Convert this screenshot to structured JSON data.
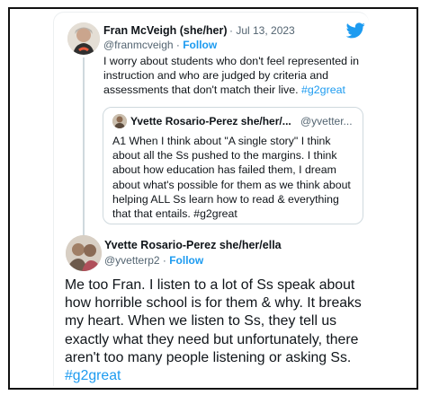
{
  "tweet": {
    "author_name": "Fran McVeigh (she/her)",
    "date": "· Jul 13, 2023",
    "handle": "@franmcveigh ·",
    "follow_label": "Follow",
    "text": "I worry about students who don't feel represented in instruction and who are judged by criteria and assessments that don't match their live.",
    "hashtag": "#g2great"
  },
  "quoted_tweet": {
    "author_name": "Yvette Rosario-Perez she/her/...",
    "handle": "@yvetter...",
    "text": "A1 When I think about \"A single story\" I think about all the Ss pushed to the margins. I think about how education has failed them, I dream about what's possible for them as we think about helping ALL Ss learn how to read & everything that that entails. #g2great"
  },
  "reply": {
    "author_name": "Yvette Rosario-Perez she/her/ella",
    "handle": "@yvetterp2 ·",
    "follow_label": "Follow",
    "text": "Me too Fran. I listen to a lot of Ss speak about how horrible school is for them & why. It breaks my heart. When we listen to Ss, they tell us exactly what they need but unfortunately, there aren't too many people listening or asking Ss.",
    "hashtag": "#g2great"
  },
  "colors": {
    "accent": "#1d9bf0",
    "secondary_text": "#536471",
    "border": "#cfd9de"
  },
  "icons": {
    "platform": "twitter-bird-icon"
  }
}
